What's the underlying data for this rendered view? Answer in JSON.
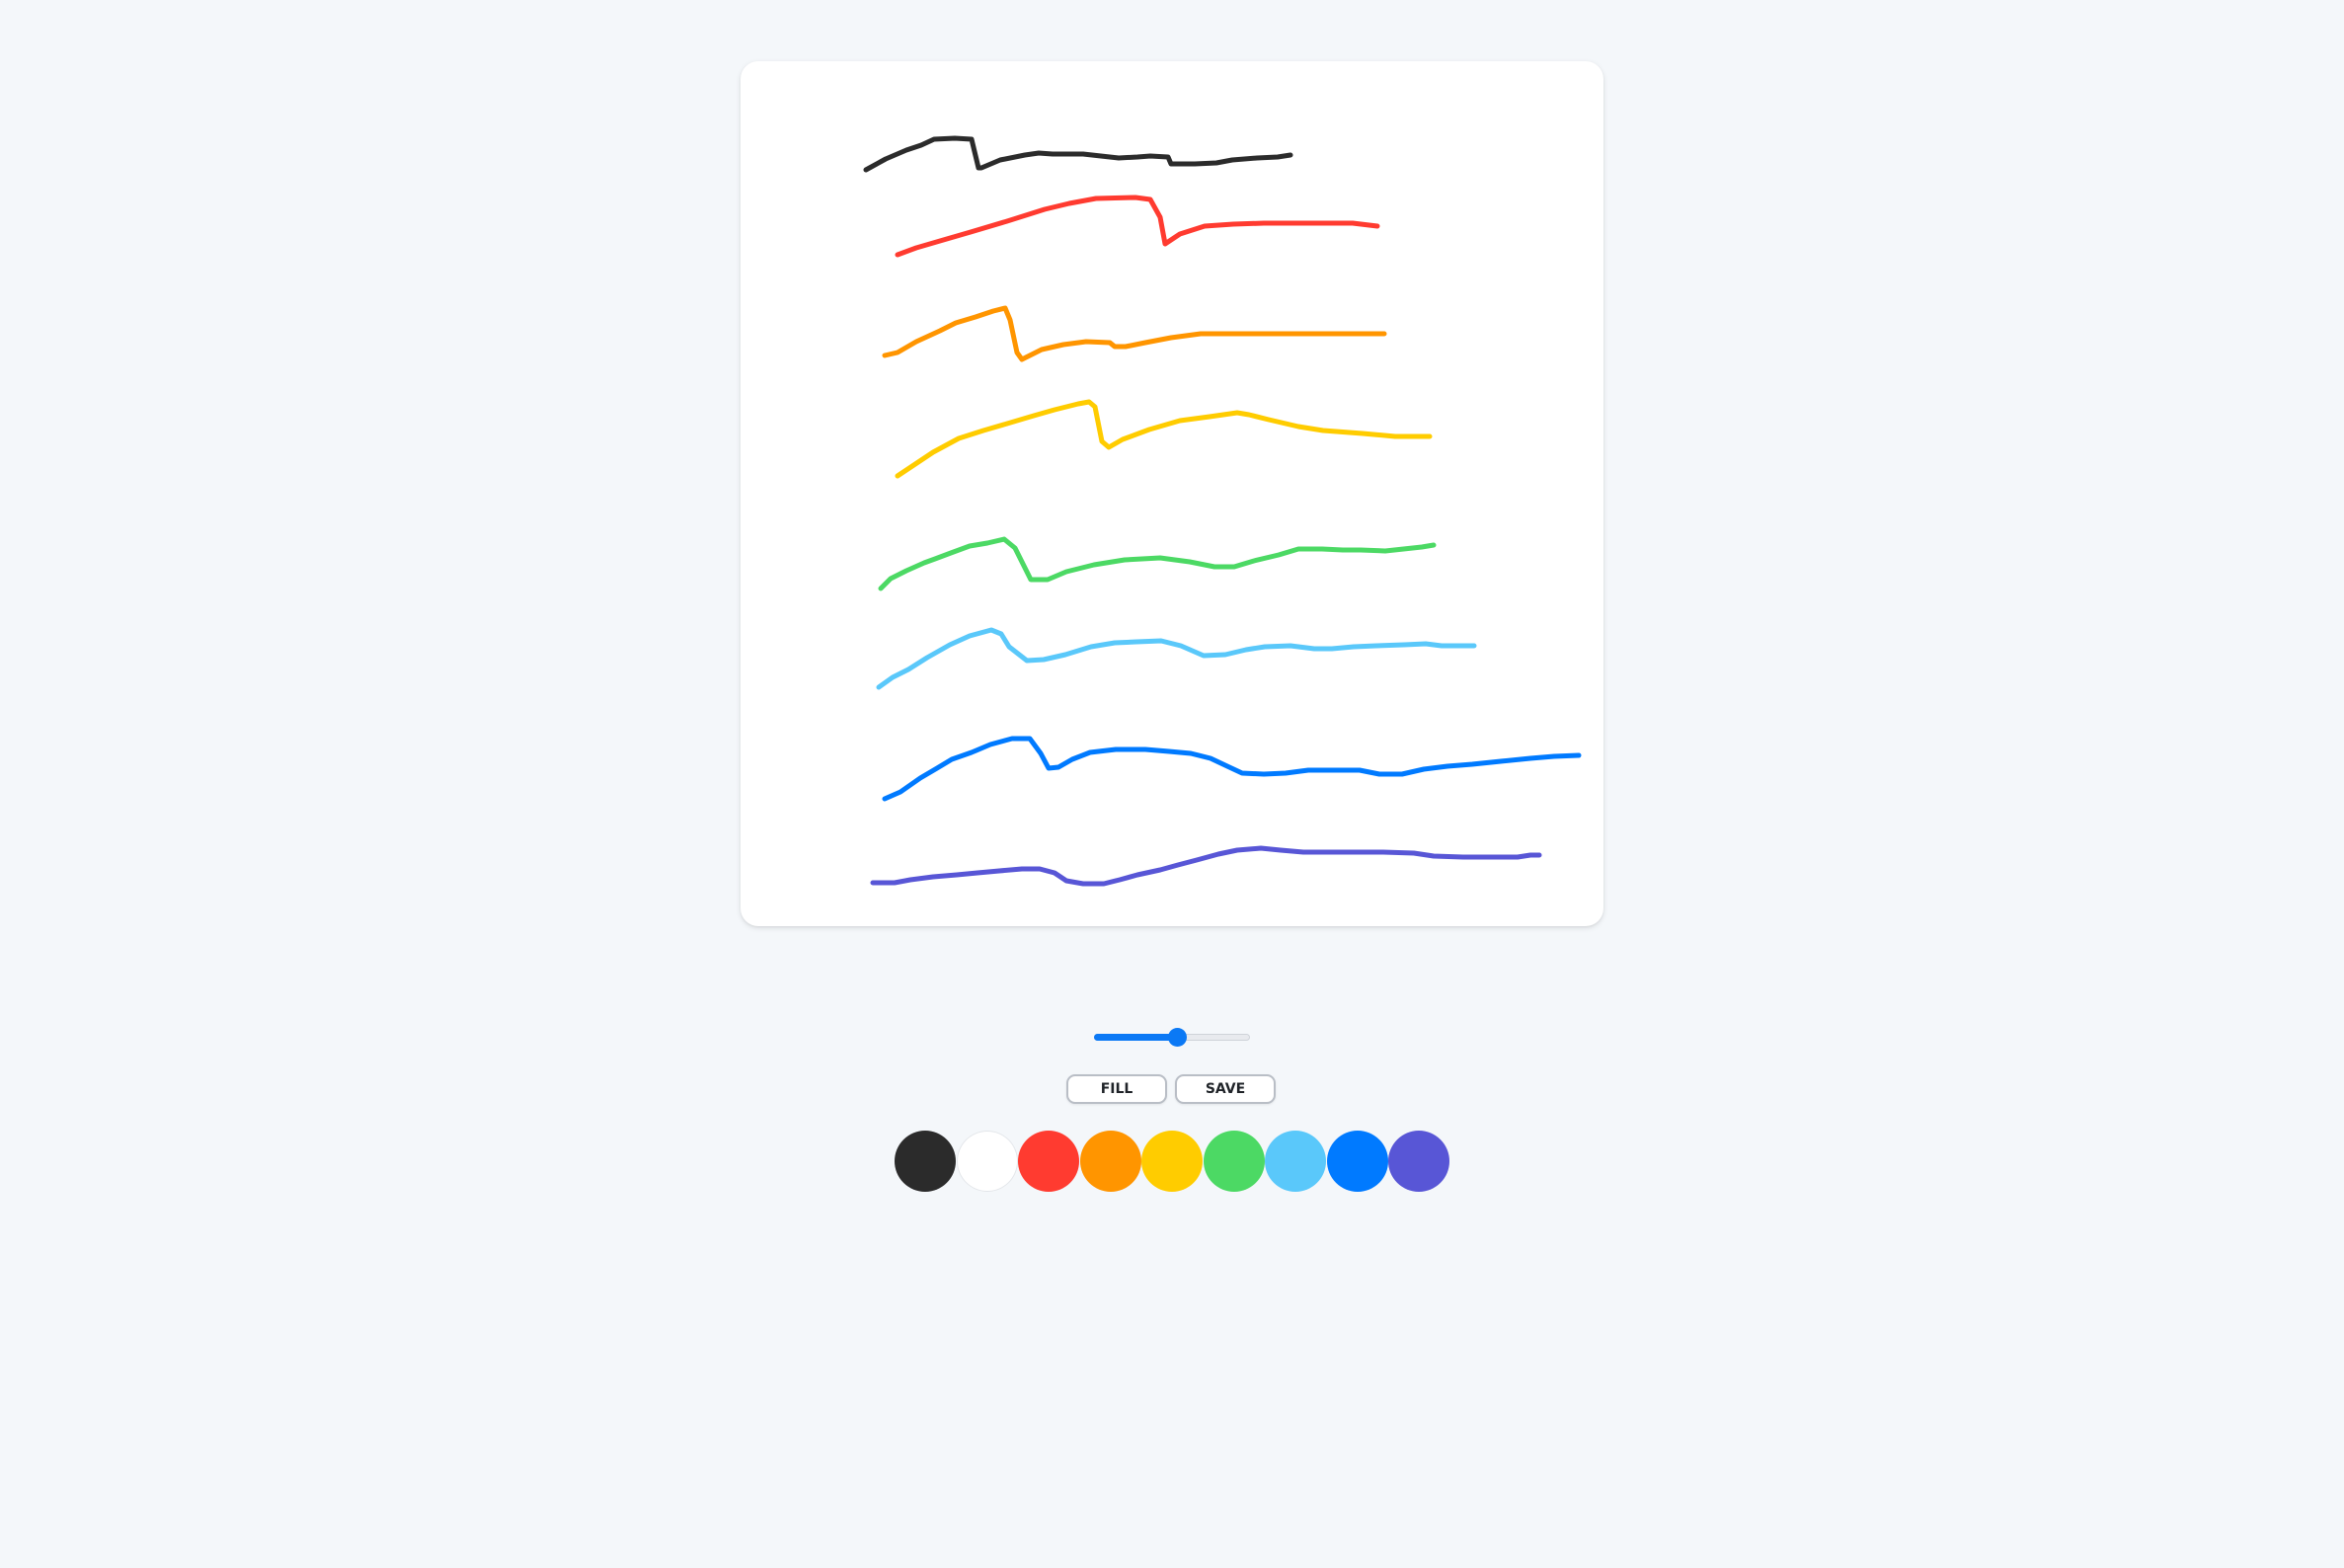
{
  "buttons": {
    "fill_label": "FILL",
    "save_label": "SAVE"
  },
  "brush_size": {
    "fraction": 0.53
  },
  "palette": [
    {
      "name": "black",
      "color": "#2b2b2b"
    },
    {
      "name": "white",
      "color": "#ffffff"
    },
    {
      "name": "red",
      "color": "#ff3b30"
    },
    {
      "name": "orange",
      "color": "#ff9500"
    },
    {
      "name": "yellow",
      "color": "#ffcc00"
    },
    {
      "name": "green",
      "color": "#4cd964"
    },
    {
      "name": "light-blue",
      "color": "#5ac8fa"
    },
    {
      "name": "blue",
      "color": "#007aff"
    },
    {
      "name": "purple",
      "color": "#5856d6"
    }
  ],
  "strokes": [
    {
      "color": "#2b2b2b"
    },
    {
      "color": "#ff3b30"
    },
    {
      "color": "#ff9500"
    },
    {
      "color": "#ffcc00"
    },
    {
      "color": "#4cd964"
    },
    {
      "color": "#5ac8fa"
    },
    {
      "color": "#007aff"
    },
    {
      "color": "#5856d6"
    }
  ]
}
